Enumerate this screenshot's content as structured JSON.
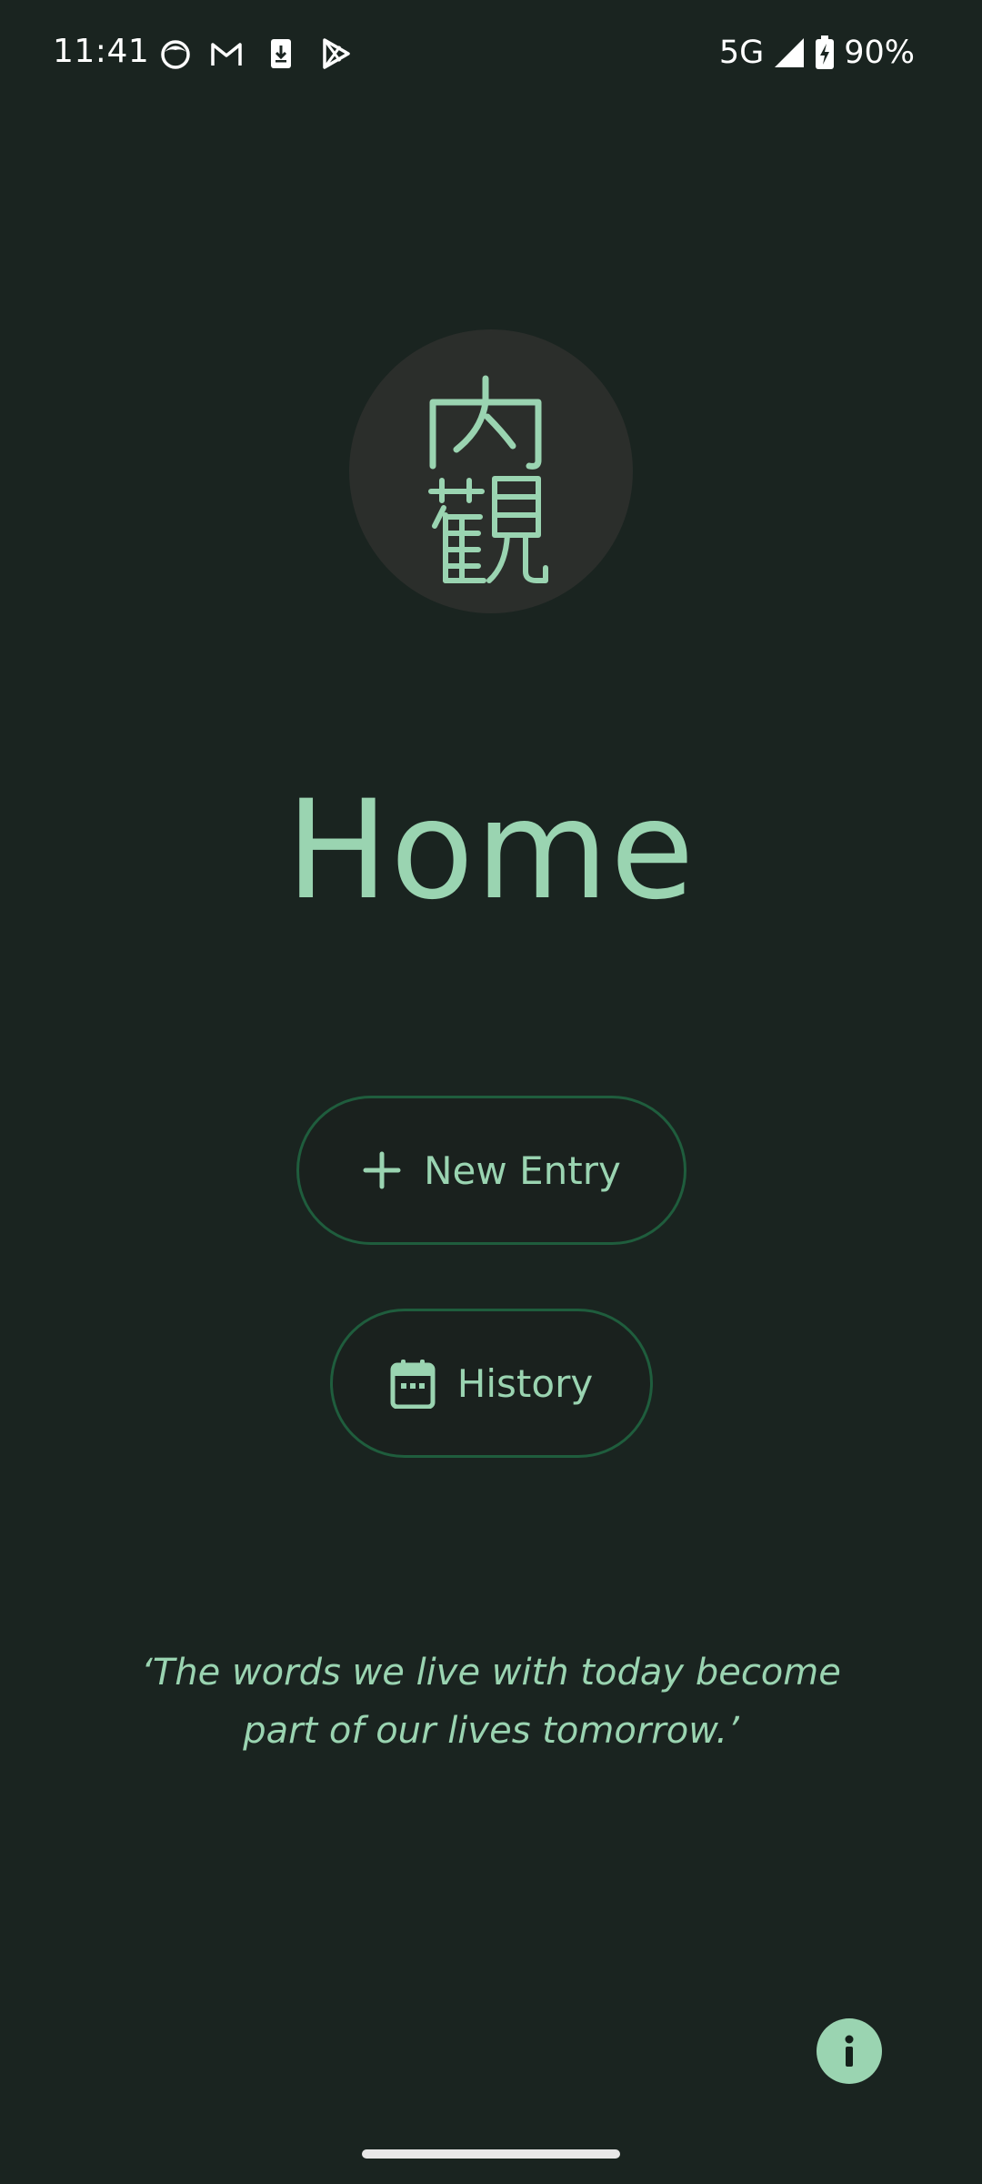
{
  "status_bar": {
    "time": "11:41",
    "network": "5G",
    "battery": "90%",
    "notification_icons": [
      "face-icon",
      "gmail-icon",
      "download-icon",
      "play-store-icon"
    ]
  },
  "logo": {
    "characters": "内観",
    "char_top": "内",
    "char_bottom": "観"
  },
  "page": {
    "title": "Home"
  },
  "buttons": {
    "new_entry": {
      "label": "New Entry",
      "icon": "plus-icon"
    },
    "history": {
      "label": "History",
      "icon": "calendar-icon"
    }
  },
  "quote": {
    "line1": "‘The words we live with today become",
    "line2": "part of our lives tomorrow.’"
  },
  "info_button": {
    "icon": "info-icon"
  },
  "colors": {
    "background": "#1a2420",
    "accent": "#9ad4b1",
    "button_border": "#1f5d3d",
    "logo_circle": "#2b2e2b"
  }
}
